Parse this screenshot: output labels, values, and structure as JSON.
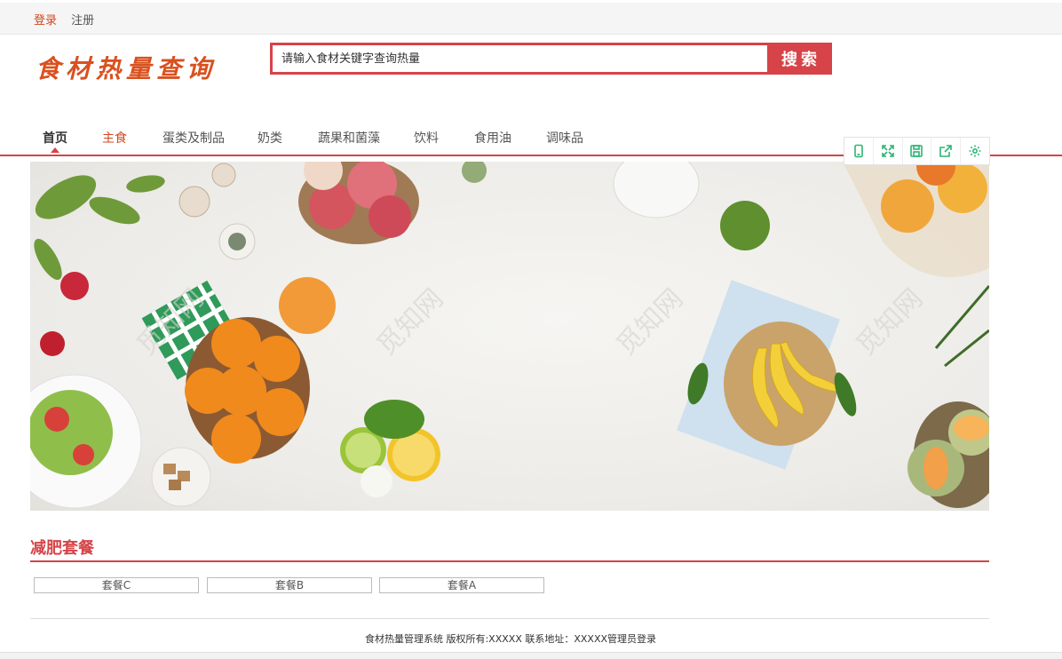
{
  "topbar": {
    "login": "登录",
    "register": "注册"
  },
  "logo": "食材热量查询",
  "search": {
    "placeholder": "请输入食材关键字查询热量",
    "button": "搜索"
  },
  "nav": {
    "items": [
      "首页",
      "主食",
      "蛋类及制品",
      "奶类",
      "蔬果和菌藻",
      "饮料",
      "食用油",
      "调味品"
    ]
  },
  "toolbox": {
    "icons": [
      "phone-icon",
      "expand-icon",
      "save-icon",
      "share-icon",
      "settings-icon"
    ],
    "color": "#2bb673"
  },
  "banner": {
    "watermark": "觅知网"
  },
  "section": {
    "title": "减肥套餐",
    "packages": [
      "套餐C",
      "套餐B",
      "套餐A"
    ]
  },
  "footer": {
    "text": "食材热量管理系统 版权所有:XXXXX 联系地址：XXXXX",
    "admin_link": "管理员登录"
  },
  "colors": {
    "accent": "#d64348",
    "logo": "#d9511f"
  }
}
